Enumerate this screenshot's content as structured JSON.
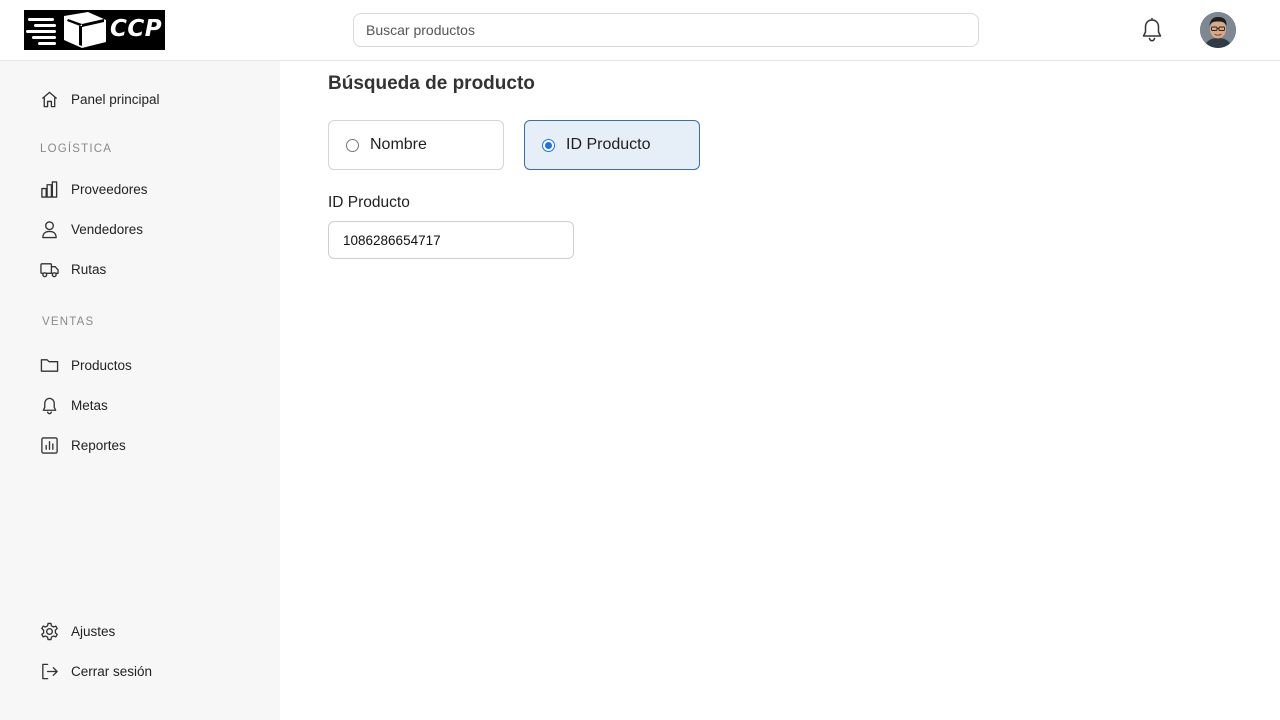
{
  "header": {
    "logo_text": "CCP",
    "search_placeholder": "Buscar productos",
    "search_value": ""
  },
  "sidebar": {
    "home": {
      "label": "Panel principal",
      "icon": "home-icon"
    },
    "sections": [
      {
        "title": "LOGÍSTICA",
        "items": [
          {
            "label": "Proveedores",
            "icon": "building-chart-icon"
          },
          {
            "label": "Vendedores",
            "icon": "user-icon"
          },
          {
            "label": "Rutas",
            "icon": "truck-icon"
          }
        ]
      },
      {
        "title": "VENTAS",
        "items": [
          {
            "label": "Productos",
            "icon": "folder-icon"
          },
          {
            "label": "Metas",
            "icon": "bell-icon"
          },
          {
            "label": "Reportes",
            "icon": "bar-chart-icon"
          }
        ]
      }
    ],
    "footer": [
      {
        "label": "Ajustes",
        "icon": "gear-icon"
      },
      {
        "label": "Cerrar sesión",
        "icon": "logout-icon"
      }
    ]
  },
  "main": {
    "title": "Búsqueda de producto",
    "search_mode": {
      "options": [
        "Nombre",
        "ID Producto"
      ],
      "selected": "ID Producto"
    },
    "field": {
      "label": "ID Producto",
      "value": "1086286654717"
    }
  },
  "colors": {
    "sidebar_bg": "#f7f7f7",
    "selected_bg": "#e6eef7",
    "selected_border": "#3a6fa8",
    "radio_accent": "#1a73e8"
  }
}
